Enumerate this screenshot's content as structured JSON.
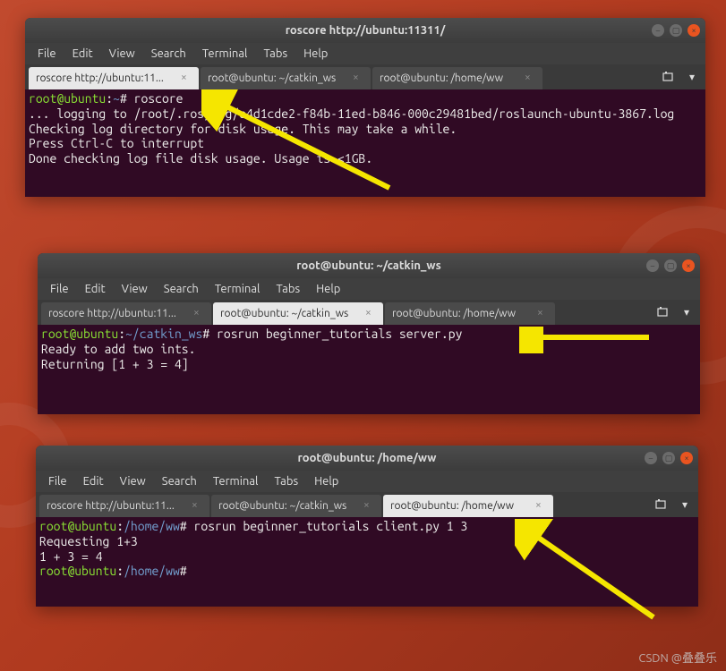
{
  "watermark": "CSDN @叠叠乐",
  "menu": {
    "file": "File",
    "edit": "Edit",
    "view": "View",
    "search": "Search",
    "terminal": "Terminal",
    "tabs": "Tabs",
    "help": "Help"
  },
  "win1": {
    "title": "roscore http://ubuntu:11311/",
    "tabs": [
      {
        "label": "roscore http://ubuntu:11...",
        "active": true
      },
      {
        "label": "root@ubuntu: ~/catkin_ws",
        "active": false
      },
      {
        "label": "root@ubuntu: /home/ww",
        "active": false
      }
    ],
    "prompt_user": "root@ubuntu",
    "prompt_sep": ":",
    "prompt_path": "~",
    "prompt_char": "# ",
    "command": "roscore",
    "output_l1": "... logging to /root/.ros/log/a4d1cde2-f84b-11ed-b846-000c29481bed/roslaunch-ubuntu-3867.log",
    "output_l2": "Checking log directory for disk usage. This may take a while.",
    "output_l3": "Press Ctrl-C to interrupt",
    "output_l4": "Done checking log file disk usage. Usage is <1GB."
  },
  "win2": {
    "title": "root@ubuntu: ~/catkin_ws",
    "tabs": [
      {
        "label": "roscore http://ubuntu:11...",
        "active": false
      },
      {
        "label": "root@ubuntu: ~/catkin_ws",
        "active": true
      },
      {
        "label": "root@ubuntu: /home/ww",
        "active": false
      }
    ],
    "prompt_user": "root@ubuntu",
    "prompt_sep": ":",
    "prompt_path": "~/catkin_ws",
    "prompt_char": "# ",
    "command": "rosrun beginner_tutorials server.py",
    "output_l1": "Ready to add two ints.",
    "output_l2": "Returning [1 + 3 = 4]"
  },
  "win3": {
    "title": "root@ubuntu: /home/ww",
    "tabs": [
      {
        "label": "roscore http://ubuntu:11...",
        "active": false
      },
      {
        "label": "root@ubuntu: ~/catkin_ws",
        "active": false
      },
      {
        "label": "root@ubuntu: /home/ww",
        "active": true
      }
    ],
    "prompt_user": "root@ubuntu",
    "prompt_sep": ":",
    "prompt_path": "/home/ww",
    "prompt_char": "# ",
    "command": "rosrun beginner_tutorials client.py 1 3",
    "output_l1": "Requesting 1+3",
    "output_l2": "1 + 3 = 4",
    "prompt2_user": "root@ubuntu",
    "prompt2_path": "/home/ww",
    "prompt2_char": "# "
  }
}
